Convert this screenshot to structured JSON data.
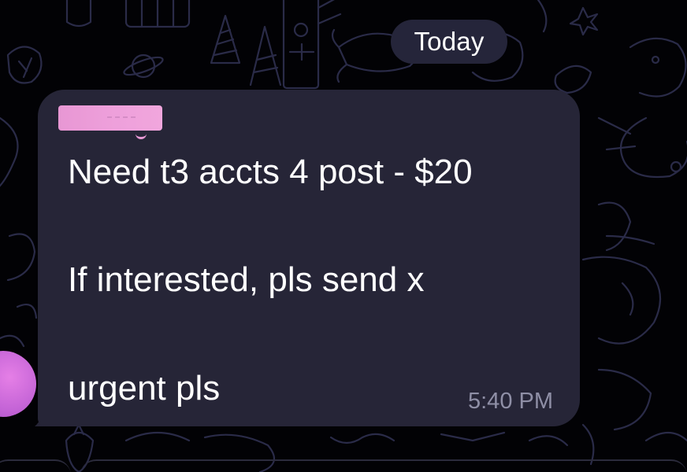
{
  "chat": {
    "date_separator": "Today",
    "message": {
      "sender_name_redacted": true,
      "lines": [
        "Need t3 accts 4 post - $20",
        "If interested, pls send x",
        "urgent pls"
      ],
      "time": "5:40 PM"
    }
  },
  "colors": {
    "background": "#020205",
    "bubble": "#262537",
    "date_pill": "#25253a",
    "message_text": "#ffffff",
    "timestamp_text": "#8f8fa6",
    "sender_name_redaction": "#ee9fdb",
    "avatar": "#c363d6"
  },
  "icons": {
    "wallpaper": "doodle-pattern-icon",
    "avatar": "avatar"
  }
}
